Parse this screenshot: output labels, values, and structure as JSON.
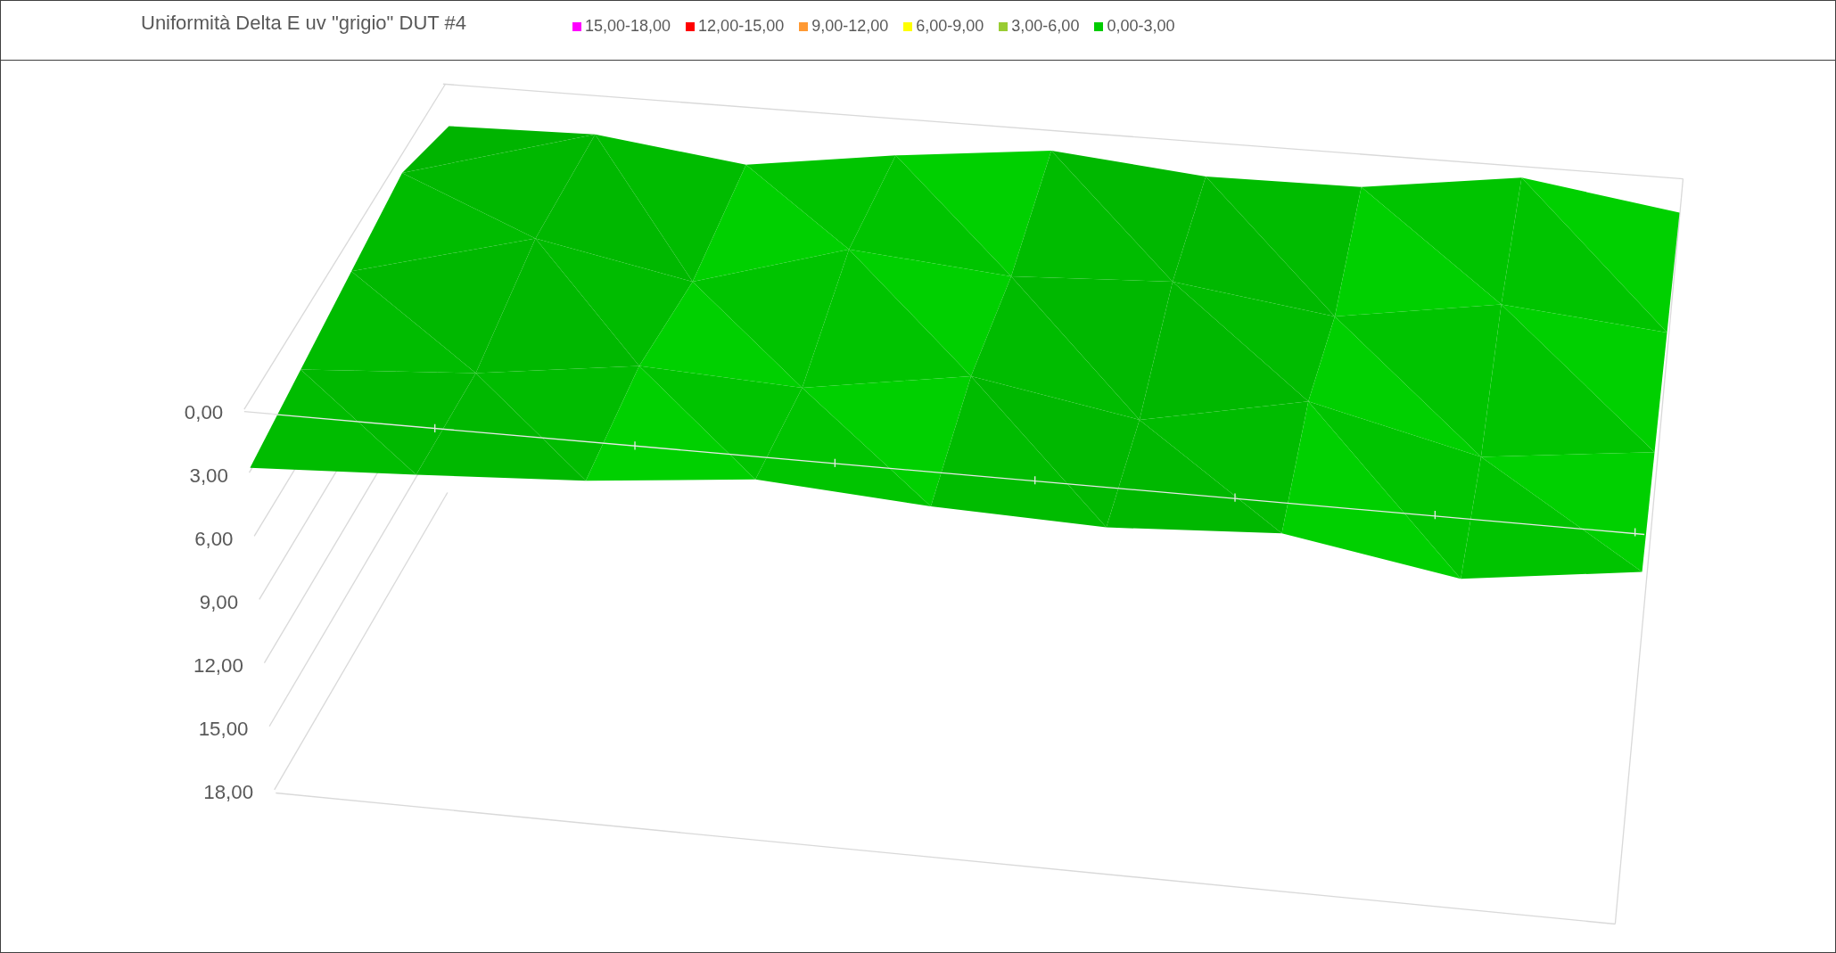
{
  "chart": {
    "title": "Uniformità Delta E uv \"grigio\" DUT #4",
    "legend": [
      {
        "label": "15,00-18,00",
        "color": "#ff00ff"
      },
      {
        "label": "12,00-15,00",
        "color": "#ff0000"
      },
      {
        "label": "9,00-12,00",
        "color": "#ff9933"
      },
      {
        "label": "6,00-9,00",
        "color": "#ffff00"
      },
      {
        "label": "3,00-6,00",
        "color": "#99cc33"
      },
      {
        "label": "0,00-3,00",
        "color": "#00cc00"
      }
    ],
    "axis_labels": [
      "0,00",
      "3,00",
      "6,00",
      "9,00",
      "12,00",
      "15,00",
      "18,00"
    ]
  }
}
